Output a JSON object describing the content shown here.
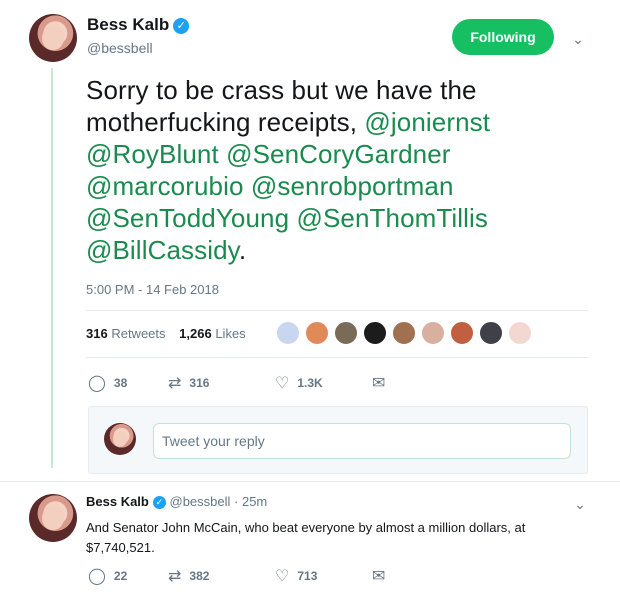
{
  "main_tweet": {
    "name": "Bess Kalb",
    "handle": "@bessbell",
    "follow_label": "Following",
    "text_parts": [
      {
        "text": "Sorry to be crass but we have the motherfucking receipts, ",
        "mention": false
      },
      {
        "text": "@joniernst",
        "mention": true
      },
      {
        "text": " ",
        "mention": false
      },
      {
        "text": "@RoyBlunt",
        "mention": true
      },
      {
        "text": " ",
        "mention": false
      },
      {
        "text": "@SenCoryGardner",
        "mention": true
      },
      {
        "text": " ",
        "mention": false
      },
      {
        "text": "@marcorubio",
        "mention": true
      },
      {
        "text": " ",
        "mention": false
      },
      {
        "text": "@senrobportman",
        "mention": true
      },
      {
        "text": " ",
        "mention": false
      },
      {
        "text": "@SenToddYoung",
        "mention": true
      },
      {
        "text": " ",
        "mention": false
      },
      {
        "text": "@SenThomTillis",
        "mention": true
      },
      {
        "text": " ",
        "mention": false
      },
      {
        "text": "@BillCassidy",
        "mention": true
      },
      {
        "text": ".",
        "mention": false
      }
    ],
    "timestamp": "5:00 PM - 14 Feb 2018",
    "retweets_count": "316",
    "retweets_label": "Retweets",
    "likes_count": "1,266",
    "likes_label": "Likes",
    "actions": {
      "reply_count": "38",
      "retweet_count": "316",
      "like_count": "1.3K"
    }
  },
  "liker_colors": [
    "#c9d6f0",
    "#e08a5a",
    "#7a6a58",
    "#1c1c1c",
    "#a07050",
    "#d8b0a0",
    "#c06040",
    "#404048",
    "#f2d8d0"
  ],
  "reply_box": {
    "placeholder": "Tweet your reply"
  },
  "second_tweet": {
    "name": "Bess Kalb",
    "handle": "@bessbell",
    "time": "· 25m",
    "text": "And Senator John McCain, who beat everyone by almost a million dollars, at $7,740,521.",
    "actions": {
      "reply_count": "22",
      "retweet_count": "382",
      "like_count": "713"
    }
  },
  "icons": {
    "reply": "reply-icon",
    "retweet": "retweet-icon",
    "like": "heart-icon",
    "dm": "envelope-icon",
    "verified": "verified-badge-icon",
    "menu": "chevron-down-icon"
  },
  "colors": {
    "accent": "#17bf63",
    "mention": "#1a8b4e",
    "verified": "#1da1f2",
    "thread_line": "#c4ead2"
  }
}
